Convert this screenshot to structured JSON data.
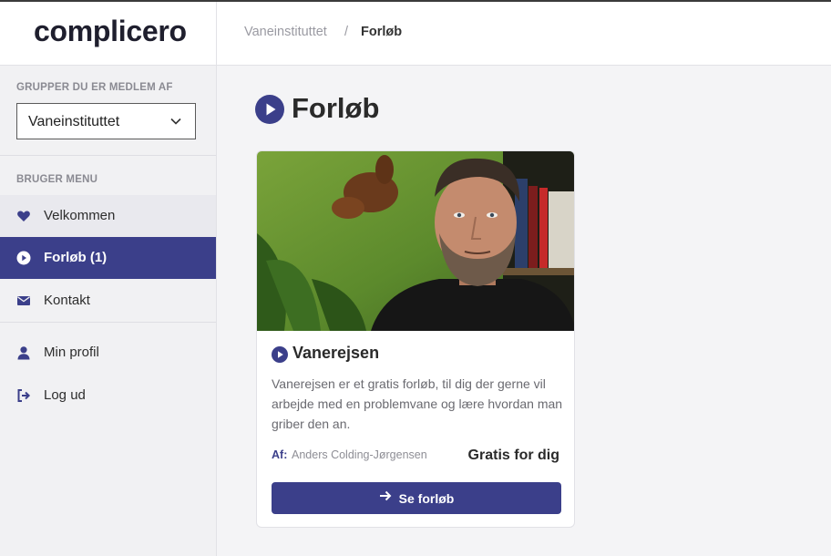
{
  "app": {
    "logo": "complicero"
  },
  "breadcrumb": {
    "items": [
      "Vaneinstituttet",
      "Forløb"
    ],
    "separator": "/"
  },
  "sidebar": {
    "groups_heading": "GRUPPER DU ER MEDLEM AF",
    "group_select": {
      "value": "Vaneinstituttet"
    },
    "menu_heading": "BRUGER MENU",
    "items": [
      {
        "label": "Velkommen",
        "icon": "heart-icon"
      },
      {
        "label": "Forløb (1)",
        "icon": "play-circle-icon",
        "active": true
      },
      {
        "label": "Kontakt",
        "icon": "envelope-icon"
      },
      {
        "label": "Min profil",
        "icon": "user-icon"
      },
      {
        "label": "Log ud",
        "icon": "logout-icon"
      }
    ]
  },
  "main": {
    "title": "Forløb",
    "course": {
      "title": "Vanerejsen",
      "description": "Vanerejsen er et gratis forløb, til dig der gerne vil arbejde med en problemvane og lære hvordan man griber den an.",
      "author_label": "Af:",
      "author": "Anders Colding-Jørgensen",
      "price": "Gratis for dig",
      "button_label": "Se forløb"
    }
  },
  "colors": {
    "accent": "#3b3f8a",
    "background": "#f4f4f6"
  }
}
